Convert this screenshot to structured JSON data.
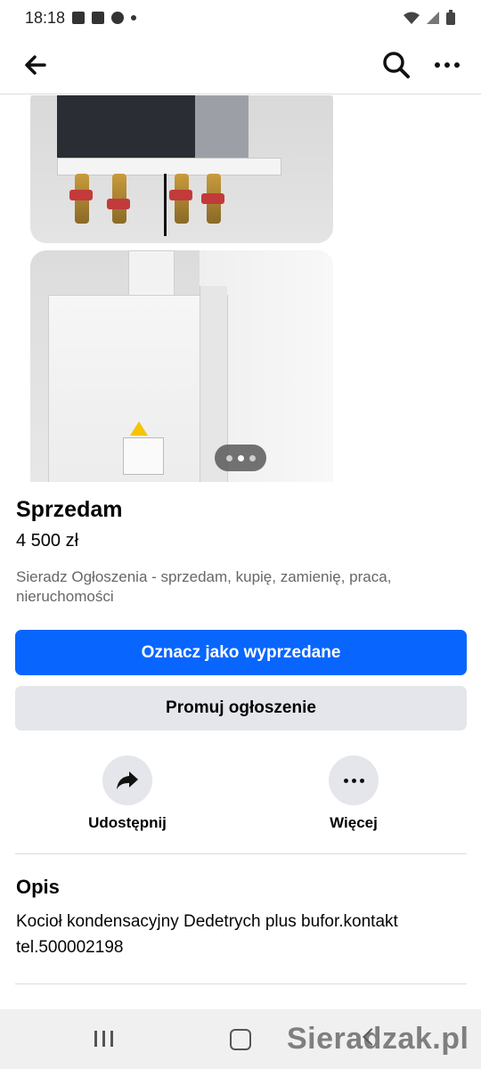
{
  "status_bar": {
    "time": "18:18",
    "left_icons": [
      "gmail-icon",
      "gallery-icon",
      "chrome-icon",
      "notification-dot-icon"
    ],
    "right_icons": [
      "wifi-icon",
      "signal-icon",
      "battery-icon"
    ]
  },
  "top_bar": {
    "icons": [
      "back-arrow-icon",
      "search-icon",
      "more-dots-icon"
    ]
  },
  "gallery": {
    "photo_count_indicator": 3,
    "active_index": 1
  },
  "listing": {
    "title": "Sprzedam",
    "price": "4 500 zł",
    "group": "Sieradz Ogłoszenia - sprzedam, kupię, zamienię, praca, nieruchomości"
  },
  "buttons": {
    "mark_sold": "Oznacz jako wyprzedane",
    "promote": "Promuj ogłoszenie"
  },
  "actions": {
    "share_label": "Udostępnij",
    "more_label": "Więcej"
  },
  "description": {
    "heading": "Opis",
    "text": "Kocioł kondensacyjny Dedetrych plus bufor.kontakt tel.500002198"
  },
  "watermark": "Sieradzak.pl",
  "colors": {
    "primary": "#0866ff",
    "secondary_bg": "#e4e6eb",
    "muted_text": "#65676b"
  }
}
